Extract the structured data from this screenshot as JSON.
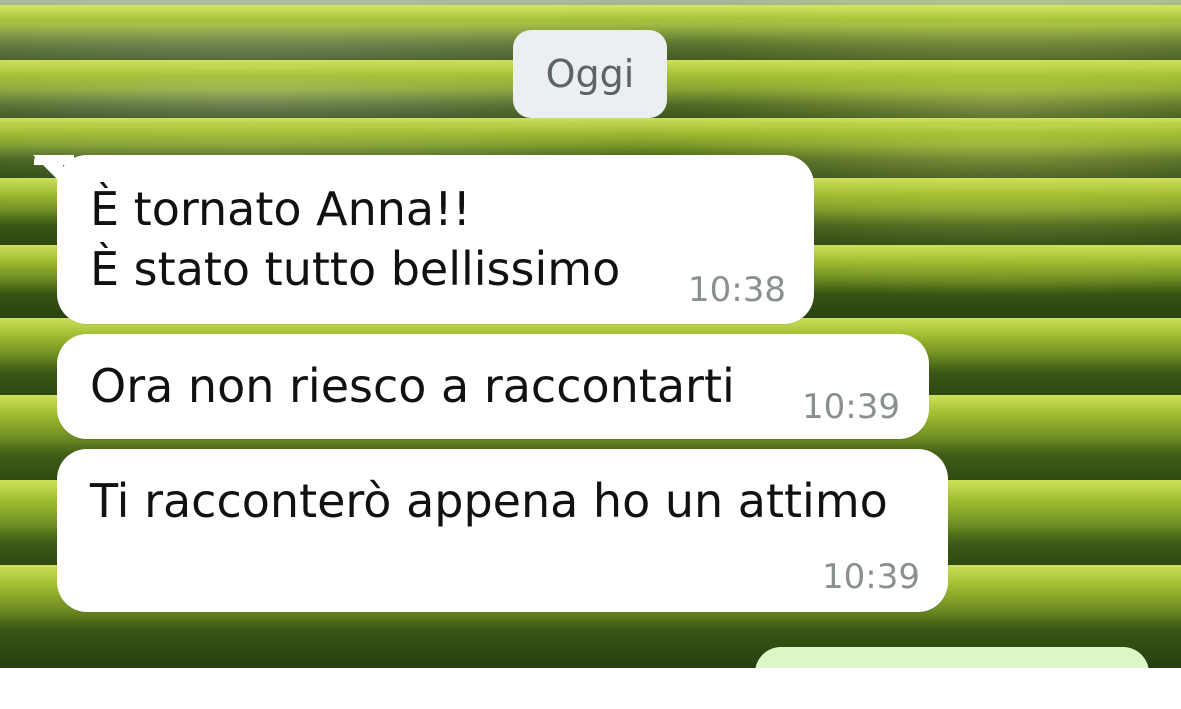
{
  "chat": {
    "date_separator": "Oggi",
    "messages": [
      {
        "direction": "incoming",
        "lines": [
          "È tornato Anna!!",
          "È stato tutto bellissimo"
        ],
        "time": "10:38"
      },
      {
        "direction": "incoming",
        "lines": [
          "Ora non riesco a raccontarti"
        ],
        "time": "10:39"
      },
      {
        "direction": "incoming",
        "lines": [
          "Ti racconterò appena ho un attimo"
        ],
        "time": "10:39"
      }
    ],
    "outgoing_preview_color": "#dcf8c6",
    "incoming_bubble_color": "#ffffff",
    "wallpaper": "green rice terraces"
  }
}
